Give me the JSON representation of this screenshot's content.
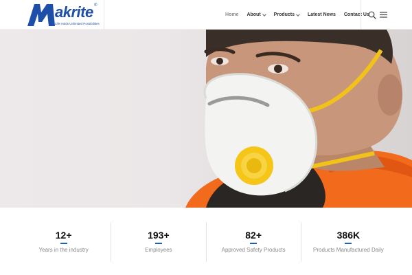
{
  "brand": {
    "name": "Makrite",
    "registered": "®",
    "tagline": "Life Holds Unlimited Possibilities",
    "color": "#1e4fa8"
  },
  "nav": {
    "items": [
      {
        "label": "Home",
        "active": true,
        "dropdown": false
      },
      {
        "label": "About",
        "active": false,
        "dropdown": true
      },
      {
        "label": "Products",
        "active": false,
        "dropdown": true
      },
      {
        "label": "Latest News",
        "active": false,
        "dropdown": false
      },
      {
        "label": "Contact Us",
        "active": false,
        "dropdown": false
      }
    ],
    "icons": [
      "search-icon",
      "hamburger-menu-icon"
    ]
  },
  "hero": {
    "image": "man wearing white respirator mask with yellow valve"
  },
  "stats": [
    {
      "value": "12+",
      "label": "Years in the industry"
    },
    {
      "value": "193+",
      "label": "Employees"
    },
    {
      "value": "82+",
      "label": "Approved Safety Products"
    },
    {
      "value": "386K",
      "label": "Products Manufactured Daily"
    }
  ],
  "colors": {
    "accent": "#1e5fb8",
    "mask_valve": "#f5c518",
    "jacket": "#f26a1b"
  }
}
